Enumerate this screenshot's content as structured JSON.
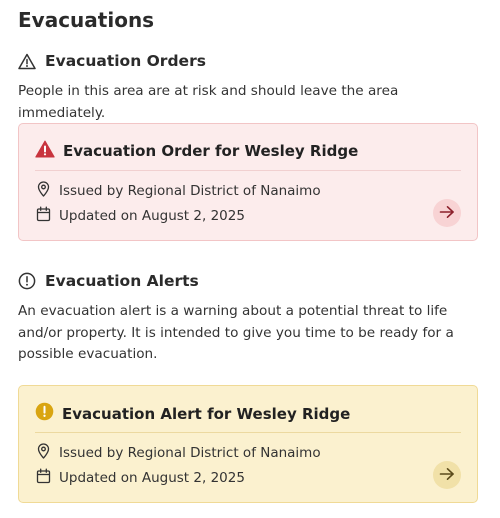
{
  "page": {
    "title": "Evacuations"
  },
  "orders_section": {
    "heading": "Evacuation Orders",
    "icon": "warning-outline-icon",
    "description": "People in this area are at risk and should leave the area immediately.",
    "card": {
      "title": "Evacuation Order for Wesley Ridge",
      "icon": "warning-filled-icon",
      "issued_by": "Issued by Regional District of Nanaimo",
      "updated": "Updated on August 2, 2025",
      "accent_color": "#c8343e",
      "background_color": "#fcecec"
    }
  },
  "alerts_section": {
    "heading": "Evacuation Alerts",
    "icon": "info-circle-outline-icon",
    "description": "An evacuation alert is a warning about a potential threat to life and/or property. It is intended to give you time to be ready for a possible evacuation.",
    "card": {
      "title": "Evacuation Alert for Wesley Ridge",
      "icon": "exclamation-circle-filled-icon",
      "issued_by": "Issued by Regional District of Nanaimo",
      "updated": "Updated on August 2, 2025",
      "accent_color": "#d9a511",
      "background_color": "#fbf1cf"
    }
  }
}
